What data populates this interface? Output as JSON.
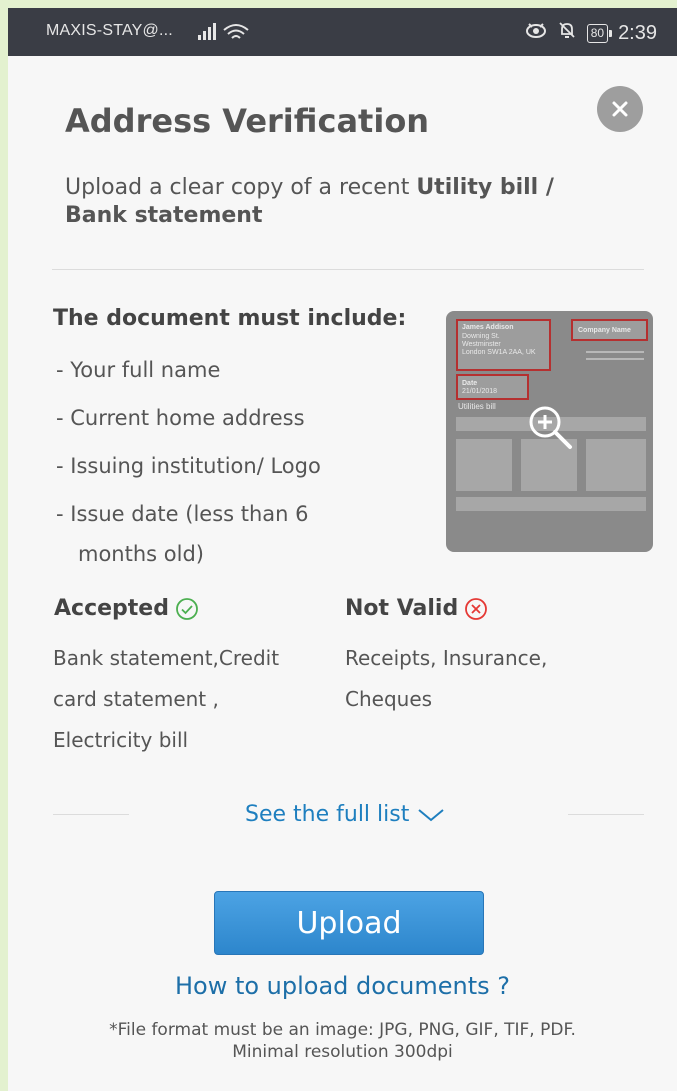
{
  "status_bar": {
    "carrier": "MAXIS-STAY@...",
    "battery": "80",
    "time": "2:39",
    "icons": [
      "signal-icon",
      "wifi-icon",
      "eye-icon",
      "bell-off-icon",
      "battery-icon"
    ]
  },
  "dialog": {
    "title": "Address Verification",
    "subtitle_prefix": "Upload a clear copy of a recent ",
    "subtitle_bold": "Utility bill / Bank statement",
    "must_include_title": "The document must include:",
    "requirements": [
      "- Your full name",
      "- Current home address",
      "- Issuing institution/ Logo",
      "- Issue date (less than 6",
      "months old)"
    ],
    "preview": {
      "name": "James Addison",
      "address_lines": [
        "Downing St.",
        "Westminster",
        "London SW1A 2AA, UK"
      ],
      "company": "Company Name",
      "date_label": "Date",
      "date_value": "21/01/2018",
      "doc_type": "Utilities bill",
      "icon": "zoom-in-icon"
    },
    "accepted": {
      "label": "Accepted",
      "lines": [
        "Bank statement,Credit",
        "card statement ,",
        "Electricity bill"
      ],
      "icon": "check-circle-icon",
      "color": "#4caf50"
    },
    "not_valid": {
      "label": "Not Valid",
      "lines": [
        "Receipts, Insurance,",
        "Cheques"
      ],
      "icon": "x-circle-icon",
      "color": "#e53935"
    },
    "see_full_list": "See the full list",
    "upload_label": "Upload",
    "how_to_upload": "How to upload documents ?",
    "file_note_line1": "*File format must be an image: JPG, PNG, GIF, TIF, PDF.",
    "file_note_line2": "Minimal resolution 300dpi",
    "accent_color": "#2d86cc"
  }
}
